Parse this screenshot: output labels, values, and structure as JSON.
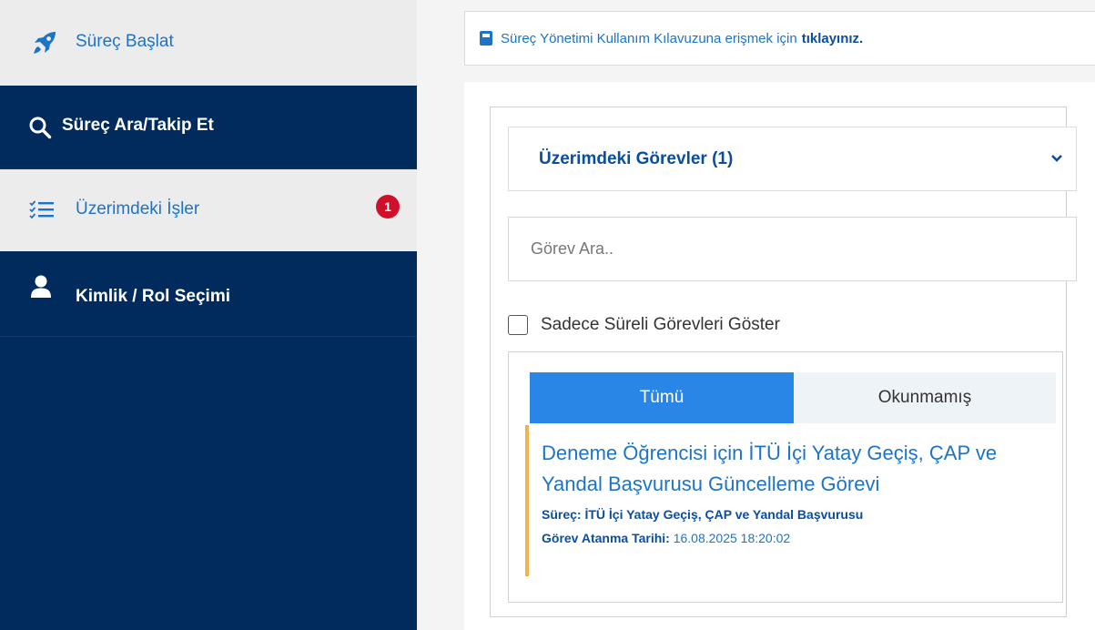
{
  "sidebar": {
    "items": [
      {
        "label": "Süreç Başlat",
        "icon": "rocket-icon"
      },
      {
        "label": "Süreç Ara/Takip Et",
        "icon": "search-icon"
      },
      {
        "label": "Üzerimdeki İşler",
        "icon": "checklist-icon",
        "badge": "1"
      },
      {
        "label": "Kimlik / Rol Seçimi",
        "icon": "user-icon"
      }
    ]
  },
  "info": {
    "text": "Süreç Yönetimi Kullanım Kılavuzuna erişmek için",
    "link": "tıklayınız."
  },
  "tasks_panel": {
    "accordion_title": "Üzerimdeki Görevler (1)",
    "search_placeholder": "Görev Ara..",
    "checkbox_label": "Sadece Süreli Görevleri Göster",
    "tabs": [
      {
        "label": "Tümü",
        "active": true
      },
      {
        "label": "Okunmamış",
        "active": false
      }
    ],
    "task": {
      "title": "Deneme Öğrencisi için İTÜ İçi Yatay Geçiş, ÇAP ve Yandal Başvurusu Güncelleme Görevi",
      "process_label": "Süreç:",
      "process_value": "İTÜ İçi Yatay Geçiş, ÇAP ve Yandal Başvurusu",
      "date_label": "Görev Atanma Tarihi:",
      "date_value": "16.08.2025 18:20:02"
    }
  },
  "colors": {
    "sidebar_bg": "#002b5c",
    "accent_blue": "#1d74c7",
    "tab_active": "#2a86e6",
    "badge_red": "#d0102a",
    "task_border": "#f2b24c"
  }
}
